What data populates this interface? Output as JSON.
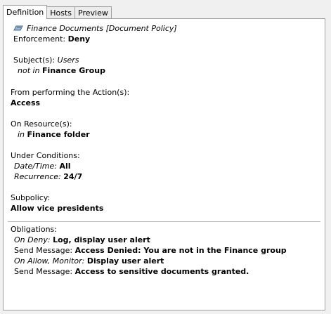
{
  "tabs": [
    {
      "label": "Definition",
      "active": true
    },
    {
      "label": "Hosts",
      "active": false
    },
    {
      "label": "Preview",
      "active": false
    }
  ],
  "policy": {
    "icon": "document-policy-icon",
    "title": "Finance Documents [Document Policy]",
    "enforcement_label": "Enforcement:",
    "enforcement_value": "Deny",
    "subjects_label": "Subject(s):",
    "subjects_type": "Users",
    "subjects_op": "not in",
    "subjects_value": "Finance Group",
    "action_label": "From performing the Action(s):",
    "action_value": "Access",
    "resource_label": "On Resource(s):",
    "resource_op": "in",
    "resource_value": "Finance folder",
    "conditions_label": "Under Conditions:",
    "datetime_label": "Date/Time:",
    "datetime_value": "All",
    "recurrence_label": "Recurrence:",
    "recurrence_value": "24/7",
    "subpolicy_label": "Subpolicy:",
    "subpolicy_value": "Allow vice presidents"
  },
  "obligations": {
    "label": "Obligations:",
    "on_deny_label": "On Deny:",
    "on_deny_value": "Log, display user alert",
    "send_msg_label_1": "Send Message:",
    "send_msg_value_1": "Access Denied: You are not in the Finance group",
    "on_allow_label": "On Allow, Monitor:",
    "on_allow_value": "Display user alert",
    "send_msg_label_2": "Send Message:",
    "send_msg_value_2": "Access to sensitive documents granted."
  }
}
